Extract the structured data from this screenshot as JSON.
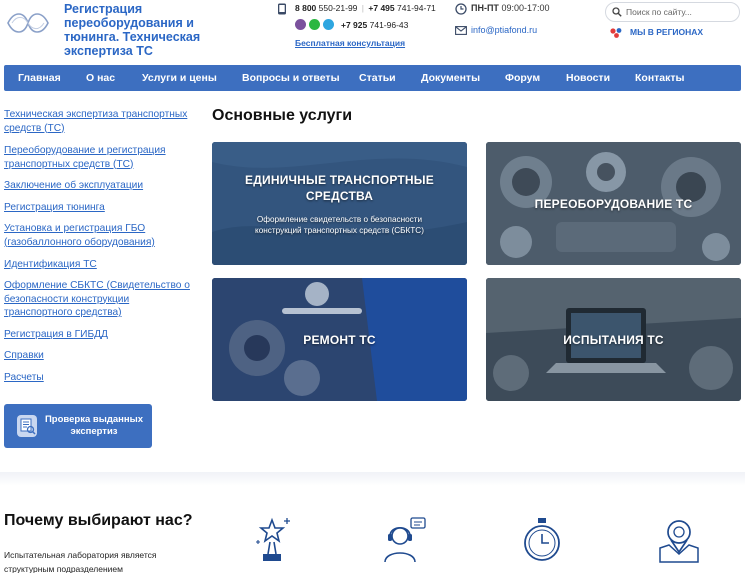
{
  "header": {
    "brand": "Регистрация переоборудования и тюнинга. Техническая экспертиза ТС",
    "phone1_code": "8 800",
    "phone1_number": "550-21-99",
    "phone2_code": "+7 495",
    "phone2_number": "741-94-71",
    "phone3_code": "+7 925",
    "phone3_number": "741-96-43",
    "consult_link": "Бесплатная консультация",
    "hours_days": "ПН-ПТ",
    "hours_time": "09:00-17:00",
    "email": "info@ptiafond.ru",
    "search_placeholder": "Поиск по сайту...",
    "regions_link": "МЫ В РЕГИОНАХ"
  },
  "nav": [
    "Главная",
    "О нас",
    "Услуги и цены",
    "Вопросы и ответы",
    "Статьи",
    "Документы",
    "Форум",
    "Новости",
    "Контакты"
  ],
  "sidebar": {
    "links": [
      "Техническая экспертиза транспортных средств (ТС)",
      "Переоборудование и регистрация транспортных средств (ТС)",
      "Заключение об эксплуатации",
      "Регистрация тюнинга",
      "Установка и регистрация ГБО (газобаллонного оборудования)",
      "Идентификация ТС",
      "Оформление СБКТС (Свидетельство о безопасности конструкции транспортного средства)",
      "Регистрация в ГИБДД",
      "Справки",
      "Расчеты"
    ],
    "check_button": "Проверка выданных экспертиз"
  },
  "main": {
    "title": "Основные услуги",
    "cards": [
      {
        "title": "ЕДИНИЧНЫЕ ТРАНСПОРТНЫЕ СРЕДСТВА",
        "desc": "Оформление свидетельств о безопасности конструкций транспортных средств (СБКТС)"
      },
      {
        "title": "ПЕРЕОБОРУДОВАНИЕ ТС"
      },
      {
        "title": "РЕМОНТ ТС"
      },
      {
        "title": "ИСПЫТАНИЯ ТС"
      }
    ]
  },
  "why": {
    "title": "Почему выбирают нас?",
    "text": "Испытательная лаборатория является структурным подразделением"
  },
  "colors": {
    "accent": "#3d6fc0",
    "link": "#2b67c5",
    "icon": "#1f4a8f"
  },
  "icons": [
    "search-icon",
    "phone-icon",
    "clock-icon",
    "mail-icon",
    "regions-icon",
    "viber-icon",
    "whatsapp-icon",
    "telegram-icon",
    "document-check-icon",
    "award-icon",
    "support-operator-icon",
    "stopwatch-icon",
    "location-map-icon"
  ]
}
